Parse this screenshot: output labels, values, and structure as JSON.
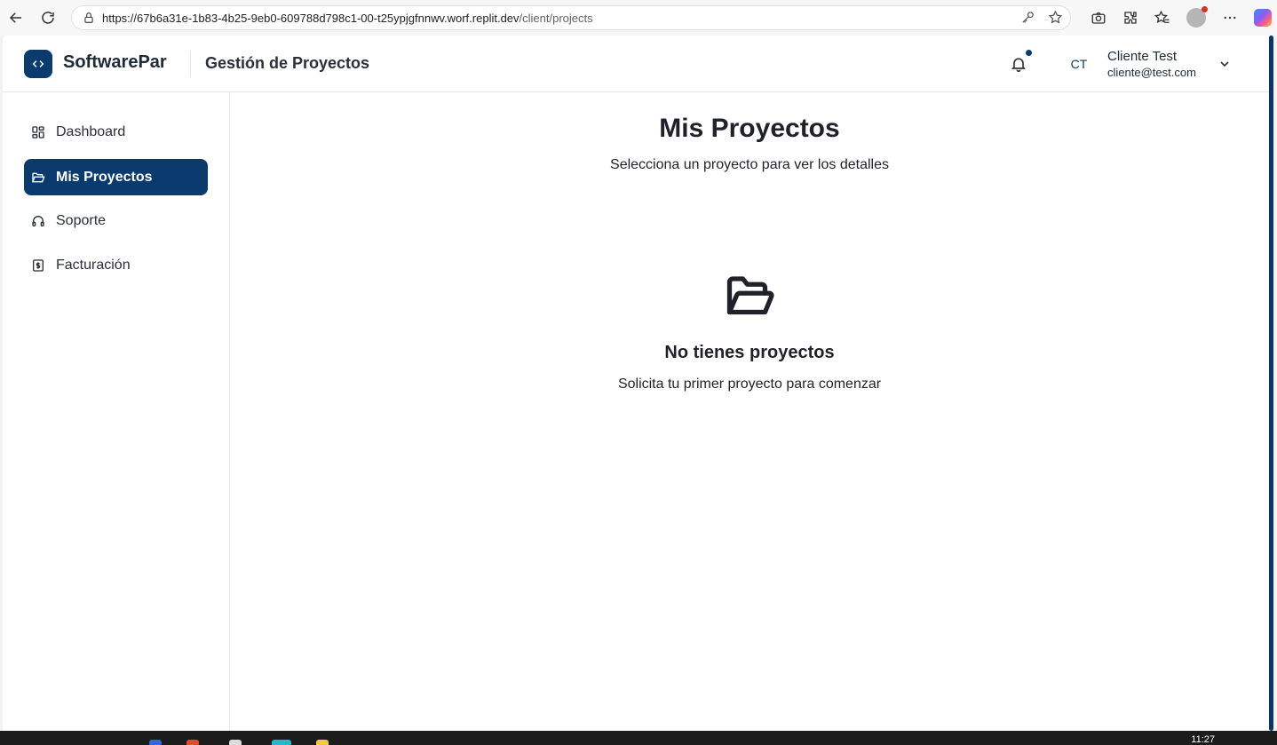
{
  "browser": {
    "url_host": "https://67b6a31e-1b83-4b25-9eb0-609788d798c1-00-t25ypjgfnnwv.worf.replit.dev",
    "url_path": "/client/projects"
  },
  "header": {
    "brand": "SoftwarePar",
    "title": "Gestión de Proyectos",
    "avatar_initials": "CT",
    "user_name": "Cliente Test",
    "user_email": "cliente@test.com"
  },
  "sidebar": {
    "items": [
      {
        "label": "Dashboard",
        "icon": "grid-icon"
      },
      {
        "label": "Mis Proyectos",
        "icon": "folder-icon",
        "active": true
      },
      {
        "label": "Soporte",
        "icon": "headphones-icon"
      },
      {
        "label": "Facturación",
        "icon": "dollar-icon"
      }
    ]
  },
  "main": {
    "title": "Mis Proyectos",
    "subtitle": "Selecciona un proyecto para ver los detalles",
    "empty_title": "No tienes proyectos",
    "empty_text": "Solicita tu primer proyecto para comenzar"
  },
  "taskbar": {
    "clock": "11:27"
  },
  "colors": {
    "primary": "#0a3a6e",
    "text": "#1f2329",
    "border": "#e5e7eb"
  }
}
